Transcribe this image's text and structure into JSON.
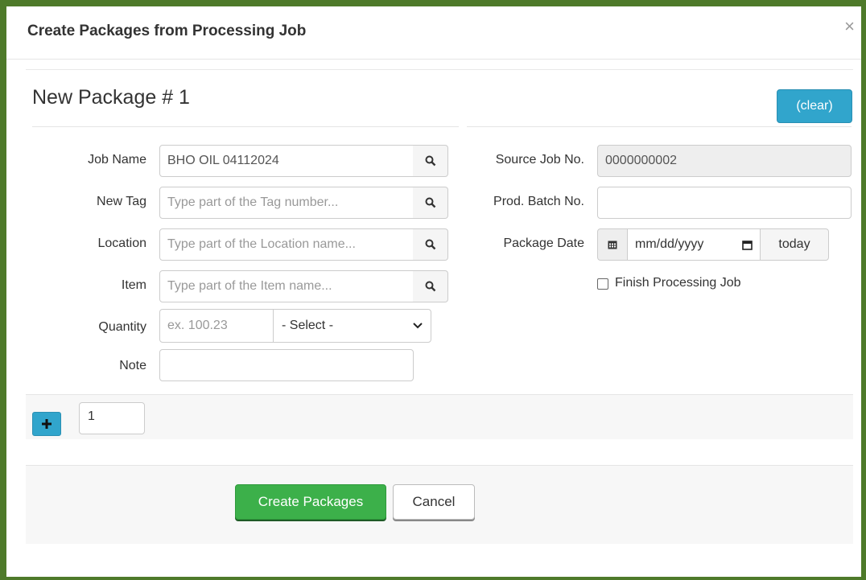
{
  "modal": {
    "title": "Create Packages from Processing Job",
    "close_label": "×"
  },
  "package": {
    "title": "New Package # 1",
    "clear_label": "(clear)"
  },
  "form": {
    "job_name": {
      "label": "Job Name",
      "value": "BHO OIL 04112024"
    },
    "new_tag": {
      "label": "New Tag",
      "placeholder": "Type part of the Tag number..."
    },
    "location": {
      "label": "Location",
      "placeholder": "Type part of the Location name..."
    },
    "item": {
      "label": "Item",
      "placeholder": "Type part of the Item name..."
    },
    "quantity": {
      "label": "Quantity",
      "placeholder": "ex. 100.23",
      "unit_selected": "- Select -"
    },
    "note": {
      "label": "Note",
      "value": ""
    },
    "source_job_no": {
      "label": "Source Job No.",
      "value": "0000000002"
    },
    "prod_batch_no": {
      "label": "Prod. Batch No.",
      "value": ""
    },
    "package_date": {
      "label": "Package Date",
      "placeholder": "mm/dd/yyyy",
      "today_label": "today"
    },
    "finish_processing_job": {
      "label": "Finish Processing Job",
      "checked": false
    }
  },
  "add_packages": {
    "count": "1"
  },
  "actions": {
    "create_label": "Create Packages",
    "cancel_label": "Cancel"
  },
  "colors": {
    "frame_border": "#4e7a2a",
    "primary_blue": "#31a5cc",
    "success_green": "#3cb04a"
  }
}
